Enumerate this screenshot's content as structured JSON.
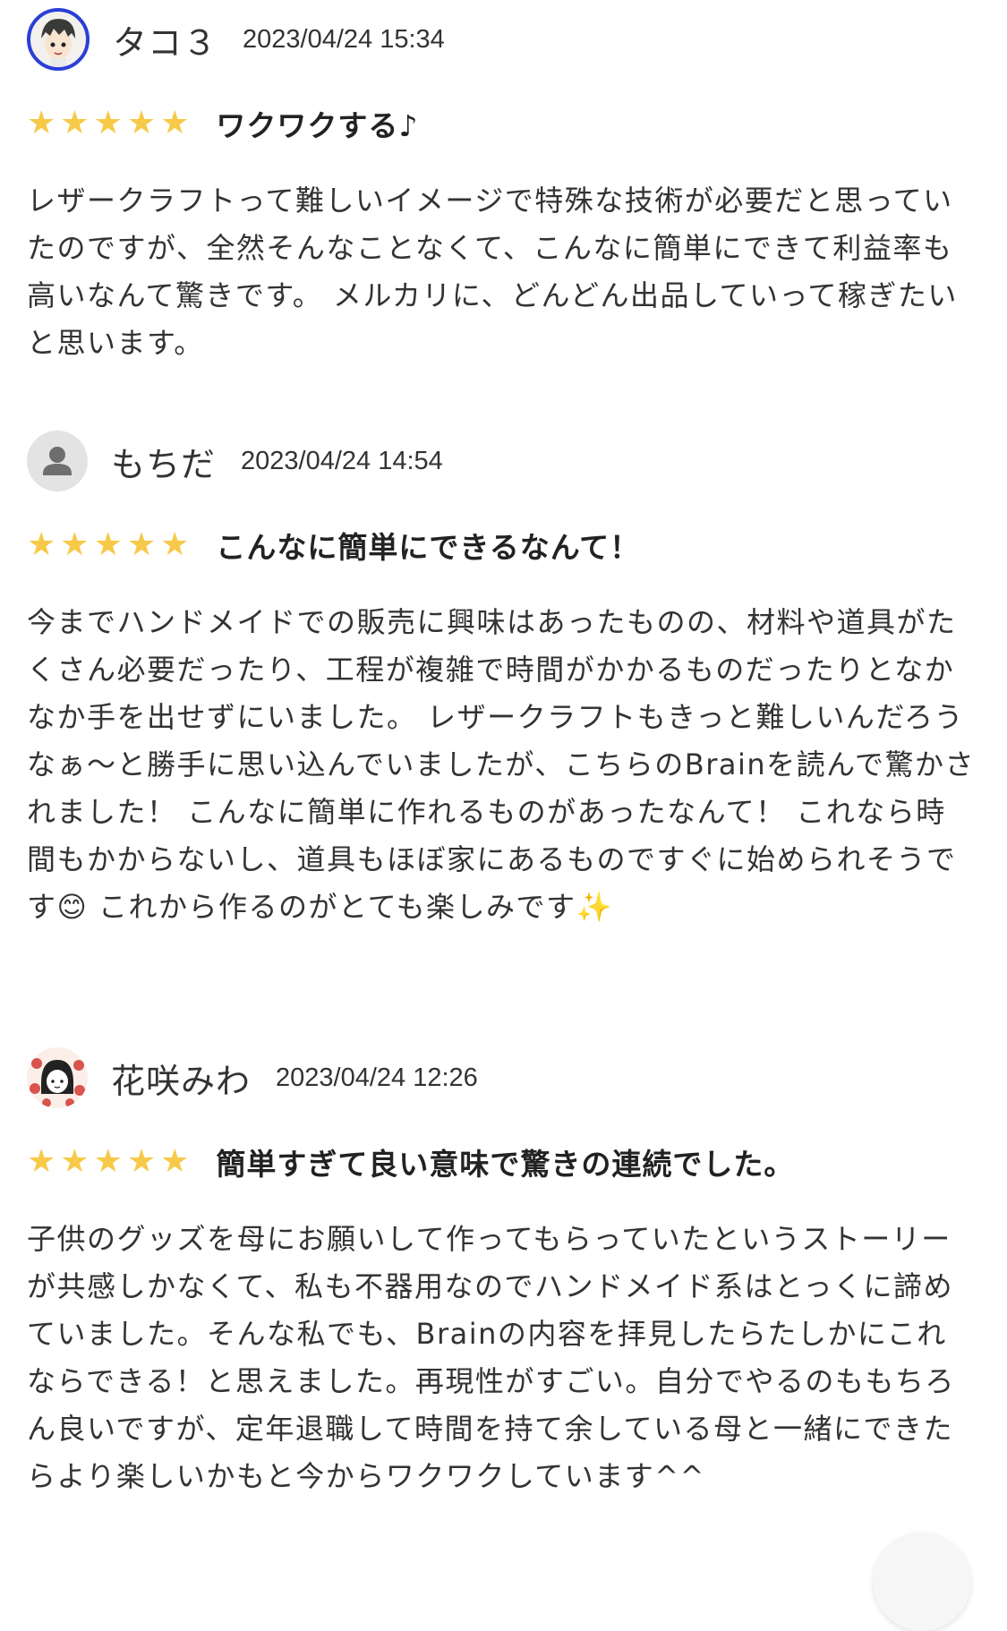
{
  "reviews": [
    {
      "name": "タコ３",
      "date": "2023/04/24 15:34",
      "stars": "★★★★★",
      "rating": 5,
      "title": "ワクワクする♪",
      "body": "レザークラフトって難しいイメージで特殊な技術が必要だと思っていたのですが、全然そんなことなくて、こんなに簡単にできて利益率も高いなんて驚きです。 メルカリに、どんどん出品していって稼ぎたいと思います。"
    },
    {
      "name": "もちだ",
      "date": "2023/04/24 14:54",
      "stars": "★★★★★",
      "rating": 5,
      "title": "こんなに簡単にできるなんて！",
      "body": "今までハンドメイドでの販売に興味はあったものの、材料や道具がたくさん必要だったり、工程が複雑で時間がかかるものだったりとなかなか手を出せずにいました。 レザークラフトもきっと難しいんだろうなぁ〜と勝手に思い込んでいましたが、こちらのBrainを読んで驚かされました！ こんなに簡単に作れるものがあったなんて！ これなら時間もかからないし、道具もほぼ家にあるものですぐに始められそうです😊 これから作るのがとても楽しみです✨"
    },
    {
      "name": "花咲みわ",
      "date": "2023/04/24 12:26",
      "stars": "★★★★★",
      "rating": 5,
      "title": "簡単すぎて良い意味で驚きの連続でした。",
      "body": "子供のグッズを母にお願いして作ってもらっていたというストーリーが共感しかなくて、私も不器用なのでハンドメイド系はとっくに諦めていました。そんな私でも、Brainの内容を拝見したらたしかにこれならできる！と思えました。再現性がすごい。自分でやるのももちろん良いですが、定年退職して時間を持て余している母と一緒にできたらより楽しいかもと今からワクワクしています^^"
    }
  ]
}
